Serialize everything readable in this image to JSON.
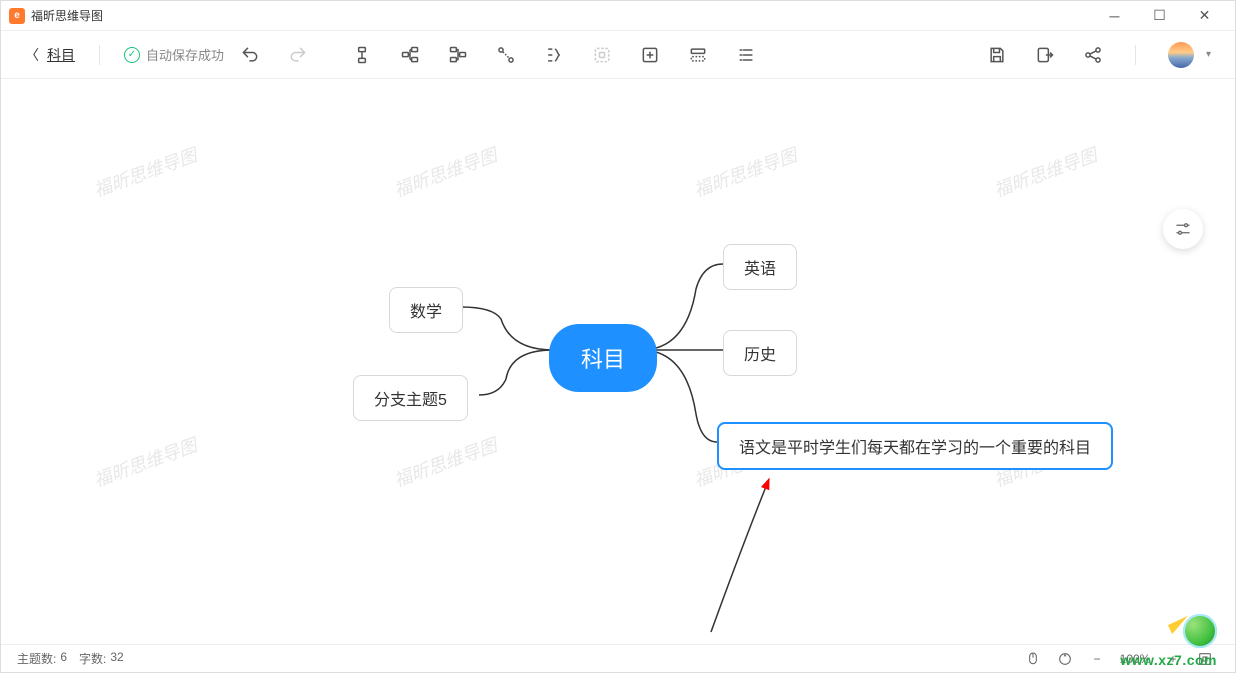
{
  "titlebar": {
    "app_name": "福昕思维导图"
  },
  "toolbar": {
    "doc_name": "科目",
    "autosave_label": "自动保存成功"
  },
  "nodes": {
    "central": "科目",
    "left1": "数学",
    "left2": "分支主题5",
    "right1": "英语",
    "right2": "历史",
    "right3": "语文是平时学生们每天都在学习的一个重要的科目"
  },
  "statusbar": {
    "topic_label": "主题数:",
    "topic_count": "6",
    "word_label": "字数:",
    "word_count": "32",
    "zoom": "100%"
  },
  "watermark_text": "福昕思维导图",
  "ext_url": "www.xz7.com"
}
